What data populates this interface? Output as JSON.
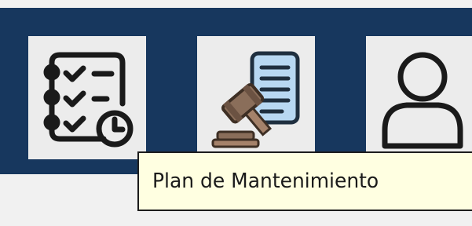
{
  "toolbar": {
    "buttons": [
      {
        "id": "maintenance-plan",
        "icon": "checklist-clock-icon"
      },
      {
        "id": "legal",
        "icon": "gavel-document-icon"
      },
      {
        "id": "user",
        "icon": "user-icon"
      }
    ]
  },
  "tooltip": {
    "text": "Plan de Mantenimiento"
  },
  "colors": {
    "toolbar_background": "#17375e",
    "button_background": "#ececec",
    "tooltip_background": "#ffffe1",
    "page_background": "#f1f1f1"
  }
}
